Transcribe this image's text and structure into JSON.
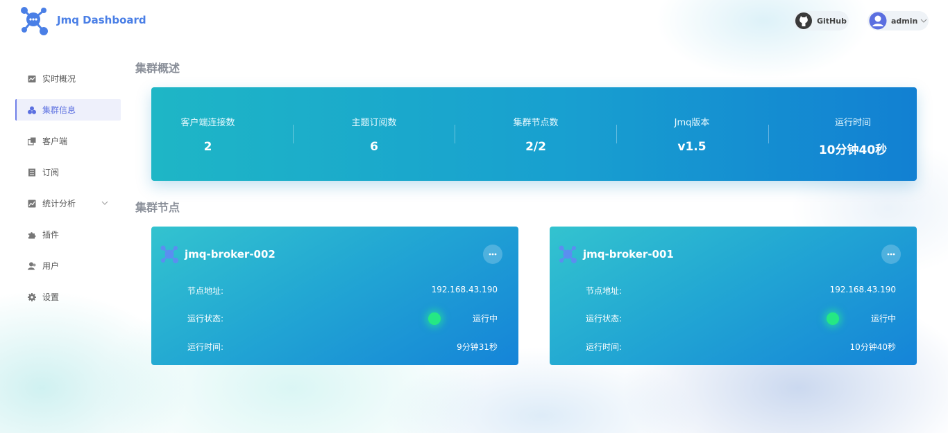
{
  "app": {
    "title": "Jmq Dashboard"
  },
  "header": {
    "github_label": "GitHub",
    "user_label": "admin"
  },
  "sidebar": {
    "items": [
      {
        "label": "实时概况",
        "icon": "chart-icon"
      },
      {
        "label": "集群信息",
        "icon": "cluster-icon",
        "active": true
      },
      {
        "label": "客户端",
        "icon": "client-icon"
      },
      {
        "label": "订阅",
        "icon": "subscribe-icon"
      },
      {
        "label": "统计分析",
        "icon": "stats-icon",
        "expandable": true
      },
      {
        "label": "插件",
        "icon": "puzzle-icon"
      },
      {
        "label": "用户",
        "icon": "user-icon"
      },
      {
        "label": "设置",
        "icon": "gear-icon"
      }
    ]
  },
  "overview": {
    "title": "集群概述",
    "stats": [
      {
        "label": "客户端连接数",
        "value": "2"
      },
      {
        "label": "主题订阅数",
        "value": "6"
      },
      {
        "label": "集群节点数",
        "value": "2/2"
      },
      {
        "label": "Jmq版本",
        "value": "v1.5"
      },
      {
        "label": "运行时间",
        "value": "10分钟40秒"
      }
    ]
  },
  "nodes": {
    "title": "集群节点",
    "list": [
      {
        "name": "jmq-broker-002",
        "address_label": "节点地址:",
        "address": "192.168.43.190",
        "status_label": "运行状态:",
        "status": "运行中",
        "uptime_label": "运行时间:",
        "uptime": "9分钟31秒"
      },
      {
        "name": "jmq-broker-001",
        "address_label": "节点地址:",
        "address": "192.168.43.190",
        "status_label": "运行状态:",
        "status": "运行中",
        "uptime_label": "运行时间:",
        "uptime": "10分钟40秒"
      }
    ]
  },
  "colors": {
    "accent": "#5b6fe0",
    "card_start": "#1eb6c6",
    "card_end": "#1280d2",
    "status_running": "#25e884"
  }
}
